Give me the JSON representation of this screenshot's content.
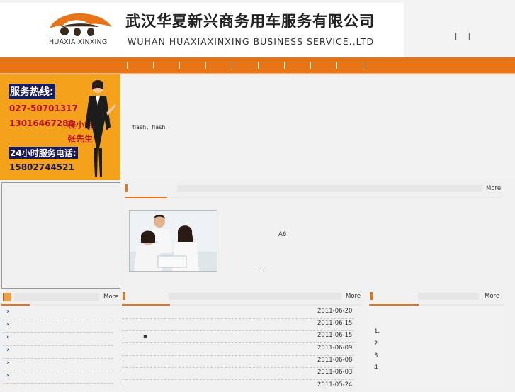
{
  "header": {
    "logo_text": "HUAXIA XINXING",
    "company_cn": "武汉华夏新兴商务用车服务有限公司",
    "company_en": "WUHAN HUAXIAXINXING BUSINESS SERVICE.,LTD",
    "top_links": [
      "|",
      "|"
    ]
  },
  "nav": {
    "separators": [
      "|",
      "|",
      "|",
      "|",
      "|",
      "|",
      "|",
      "|",
      "|",
      "|"
    ]
  },
  "hotline": {
    "title": "服务热线:",
    "phone1": "027-50701317",
    "phone2": "13016467288",
    "contact1": "程小姐",
    "contact2": "张先生",
    "label24": "24小时服务电话:",
    "phone3": "15802744521"
  },
  "flash": {
    "text": "flash，flash"
  },
  "about": {
    "more": "More",
    "a6": "A6",
    "ellipsis": "..."
  },
  "left_column": {
    "more": "More",
    "items": [
      "",
      "",
      "",
      "",
      "",
      ""
    ]
  },
  "news_column": {
    "more": "More",
    "items": [
      {
        "title": "·",
        "date": "2011-06-20"
      },
      {
        "title": "·",
        "date": "2011-06-15"
      },
      {
        "title": "·　　　▪",
        "date": "2011-06-15"
      },
      {
        "title": "·",
        "date": "2011-06-09"
      },
      {
        "title": "·",
        "date": "2011-06-08"
      },
      {
        "title": "·",
        "date": "2011-06-03"
      },
      {
        "title": "·",
        "date": "2011-05-24"
      }
    ]
  },
  "right_column": {
    "more": "More",
    "items": [
      "1.",
      "2.",
      "3.",
      "4."
    ]
  },
  "colors": {
    "accent": "#e77517",
    "hotline_bg": "#f4a21c",
    "link_blue": "#1a5fa8"
  }
}
